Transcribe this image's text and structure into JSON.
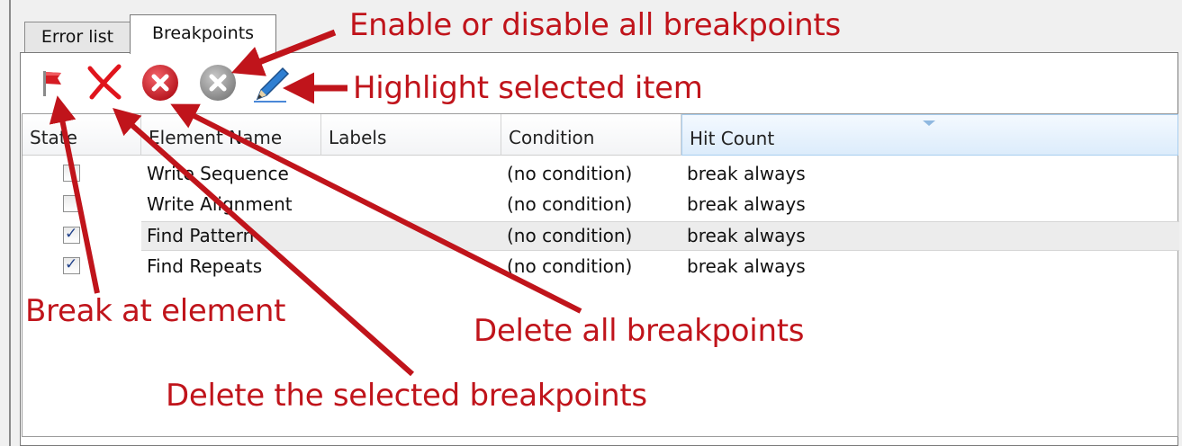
{
  "tabs": [
    {
      "label": "Error list",
      "active": false
    },
    {
      "label": "Breakpoints",
      "active": true
    }
  ],
  "toolbar": {
    "buttons": [
      {
        "name": "break-at-element",
        "icon": "flag-icon"
      },
      {
        "name": "delete-selected",
        "icon": "red-x-icon"
      },
      {
        "name": "delete-all",
        "icon": "red-circle-x-icon"
      },
      {
        "name": "toggle-all",
        "icon": "gray-circle-x-icon"
      },
      {
        "name": "highlight-selected",
        "icon": "pencil-icon"
      }
    ]
  },
  "grid": {
    "columns": [
      "State",
      "Element Name",
      "Labels",
      "Condition",
      "Hit Count"
    ],
    "sorted_column": "Hit Count",
    "rows": [
      {
        "checked": false,
        "name": "Write Sequence",
        "labels": "",
        "condition": "(no condition)",
        "hit_count": "break always"
      },
      {
        "checked": false,
        "name": "Write Alignment",
        "labels": "",
        "condition": "(no condition)",
        "hit_count": "break always"
      },
      {
        "checked": true,
        "name": "Find Pattern",
        "labels": "",
        "condition": "(no condition)",
        "hit_count": "break always",
        "selected": true
      },
      {
        "checked": true,
        "name": "Find Repeats",
        "labels": "",
        "condition": "(no condition)",
        "hit_count": "break always"
      }
    ]
  },
  "annotations": {
    "enable_disable": "Enable or disable all breakpoints",
    "highlight": "Highlight selected item",
    "break_at_element": "Break at element",
    "delete_all": "Delete all breakpoints",
    "delete_selected": "Delete the selected breakpoints"
  },
  "colors": {
    "annotation": "#c0141b",
    "window_bg": "#f0f0f0",
    "check_mark": "#21428b",
    "sorted_header": "#dcecfb"
  }
}
